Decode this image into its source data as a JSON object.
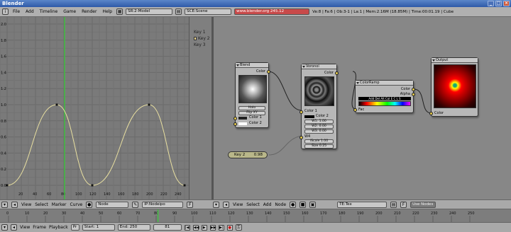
{
  "window": {
    "title": "Blender"
  },
  "menu": {
    "items": [
      "File",
      "Add",
      "Timeline",
      "Game",
      "Render",
      "Help"
    ],
    "screen_field": "SR:2-Model",
    "scene_field": "SCE:Scene",
    "url": "www.blender.org 245.12",
    "stats": "Ve:8 | Fa:6 | Ob:3-1 | La:1 | Mem:2.16M (18.85M) | Time:00:01.19 | Cube"
  },
  "ipo": {
    "y_ticks": [
      "2.0",
      "1.8",
      "1.6",
      "1.4",
      "1.2",
      "1.0",
      "0.8",
      "0.6",
      "0.4",
      "0.2",
      "0.0"
    ],
    "x_ticks": [
      "20",
      "40",
      "60",
      "80",
      "100",
      "120",
      "140",
      "160",
      "180",
      "200",
      "220",
      "240"
    ],
    "channels": [
      "Key 1",
      "Key 2",
      "Key 3"
    ],
    "current_frame_line": 81,
    "curve_color": "#e8dfa0"
  },
  "nodes": {
    "blend": {
      "title": "Blend",
      "out": "Color",
      "type_field": "Halo",
      "flip_field": "Flip XY",
      "in1": "Color 1",
      "in2": "Color 2"
    },
    "voronoi": {
      "title": "Voronoi",
      "out": "Color",
      "in1": "Color 1",
      "in2": "Color 2",
      "w1": "W1: 1.00",
      "w2": "W2: 0.00",
      "w3": "W3: 0.00",
      "w4": "W4",
      "iscale": "iScale 1.00",
      "size": "Size 0.25"
    },
    "colorramp": {
      "title": "ColorRamp",
      "out1": "Color",
      "out2": "Alpha",
      "in": "Fac",
      "buttons": "Add Del Alt Col E C L S"
    },
    "output": {
      "title": "Output",
      "in": "Color"
    },
    "key": {
      "label": "Key 2",
      "value": "0.98"
    }
  },
  "ipo_header": {
    "items": [
      "View",
      "Select",
      "Marker",
      "Curve"
    ],
    "node_field": "Node",
    "ipo_field": "IP:Nodeipo"
  },
  "node_header": {
    "items": [
      "View",
      "Select",
      "Add",
      "Node"
    ],
    "tex_field": "TE:Tex",
    "use_nodes": "Use Nodes"
  },
  "timeline": {
    "ticks": [
      "0",
      "10",
      "20",
      "30",
      "40",
      "50",
      "60",
      "70",
      "80",
      "90",
      "100",
      "110",
      "120",
      "130",
      "140",
      "150",
      "160",
      "170",
      "180",
      "190",
      "200",
      "210",
      "220",
      "230",
      "240",
      "250"
    ]
  },
  "timeline_header": {
    "items": [
      "View",
      "Frame",
      "Playback"
    ],
    "pr": "Pr",
    "start": "Start: 1",
    "end": "End: 250",
    "current": "81"
  }
}
